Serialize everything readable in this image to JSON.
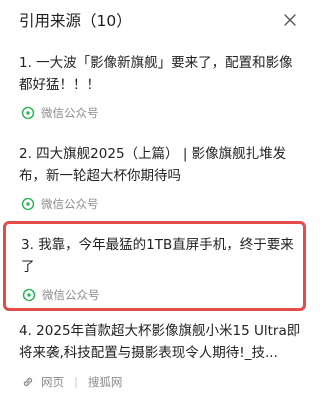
{
  "header": {
    "title": "引用来源（10）"
  },
  "references": [
    {
      "text": "1. 一大波「影像新旗舰」要来了，配置和影像都好猛！！！",
      "source": "微信公众号",
      "icon": "wechat-channel-icon"
    },
    {
      "text": "2. 四大旗舰2025（上篇） | 影像旗舰扎堆发布，新一轮超大杯你期待吗",
      "source": "微信公众号",
      "icon": "wechat-channel-icon"
    },
    {
      "text": "3. 我靠，今年最猛的1TB直屏手机，终于要来了",
      "source": "微信公众号",
      "icon": "wechat-channel-icon",
      "highlighted": true
    },
    {
      "text": "4. 2025年首款超大杯影像旗舰小米15 Ultra即将来袭,科技配置与摄影表现令人期待!_技...",
      "source": "网页",
      "site": "搜狐网",
      "icon": "link-icon"
    }
  ],
  "colors": {
    "highlight_border": "#e44b4b",
    "wechat_green": "#2bb45a",
    "muted_text": "#8a8a8a"
  }
}
